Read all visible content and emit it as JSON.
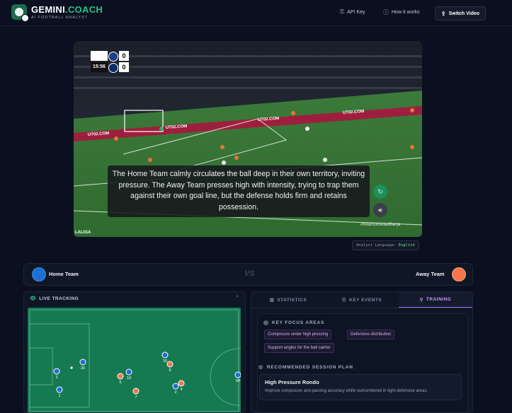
{
  "header": {
    "brand_main": "GEMINI",
    "brand_accent": ".COACH",
    "brand_sub": "AI FOOTBALL ANALYST",
    "api_key_label": "API Key",
    "how_it_works_label": "How it works",
    "switch_video_label": "Switch Video",
    "icons": {
      "api_key": "key-icon",
      "how": "question-circle-icon",
      "switch": "upload-icon"
    }
  },
  "video": {
    "scoreboard": {
      "time": "15:56",
      "home_score": "0",
      "away_score": "0"
    },
    "caption": "The Home Team calmly circulates the ball deep in their own territory, inviting pressure. The Away Team presses high with intensity, trying to trap them against their own goal line, but the defense holds firm and retains possession.",
    "hashtag": "#RealSociedadBarça",
    "league_mark": "LALIGA",
    "ad_text": "UT02.COM",
    "language_label": "Analyst Language:",
    "language_value": "English"
  },
  "teams": {
    "home": {
      "name": "Home Team",
      "color": "#1e6fd4"
    },
    "away": {
      "name": "Away Team",
      "color": "#f2784b"
    },
    "vs": "VS"
  },
  "tracking": {
    "title": "LIVE TRACKING",
    "home_players": [
      {
        "label": "3"
      },
      {
        "label": "1"
      },
      {
        "label": "26"
      },
      {
        "label": "10"
      },
      {
        "label": "16"
      },
      {
        "label": "2"
      },
      {
        "label": "84"
      }
    ],
    "away_players": [
      {
        "label": "5"
      },
      {
        "label": "7"
      },
      {
        "label": "8"
      },
      {
        "label": "4"
      }
    ]
  },
  "right_panel": {
    "tabs": [
      "STATISTICS",
      "KEY EVENTS",
      "TRAINING"
    ],
    "active_tab": "TRAINING",
    "focus_title": "KEY FOCUS AREAS",
    "focus_areas": [
      "Composure under high pressing",
      "Defensive distribution",
      "Support angles for the ball carrier"
    ],
    "plan_title": "RECOMMENDED SESSION PLAN",
    "session": {
      "title": "High Pressure Rondo",
      "description": "Improve composure and passing accuracy while outnumbered in tight defensive areas."
    }
  }
}
